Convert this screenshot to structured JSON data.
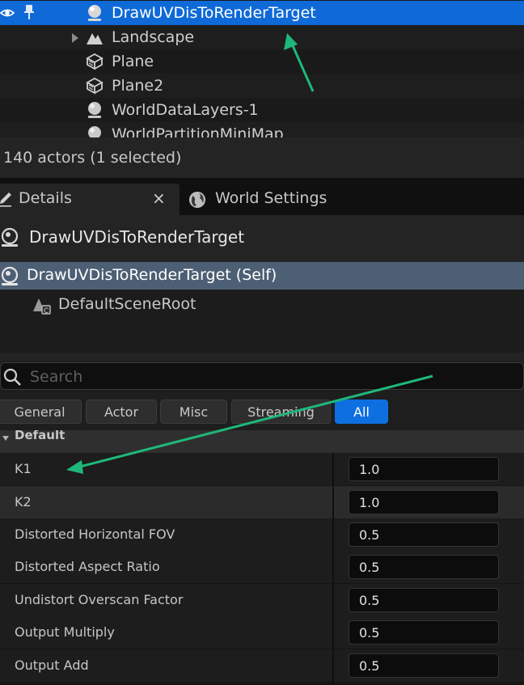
{
  "outliner": {
    "rows": [
      {
        "label": "DrawUVDisToRenderTarget",
        "icon": "actor-sphere-icon",
        "selected": true
      },
      {
        "label": "Landscape",
        "icon": "landscape-icon",
        "expandable": true
      },
      {
        "label": "Plane",
        "icon": "static-mesh-icon"
      },
      {
        "label": "Plane2",
        "icon": "static-mesh-icon"
      },
      {
        "label": "WorldDataLayers-1",
        "icon": "actor-sphere-icon"
      },
      {
        "label": "WorldPartitionMiniMap",
        "icon": "actor-sphere-icon"
      }
    ],
    "status": "140 actors (1 selected)"
  },
  "tabs": {
    "details": "Details",
    "world_settings": "World Settings",
    "close_glyph": "×"
  },
  "details": {
    "actor_name": "DrawUVDisToRenderTarget",
    "components": [
      {
        "label": "DrawUVDisToRenderTarget (Self)",
        "selected": true
      },
      {
        "label": "DefaultSceneRoot"
      }
    ],
    "search_placeholder": "Search",
    "filters": [
      "General",
      "Actor",
      "Misc",
      "Streaming",
      "All"
    ],
    "active_filter": "All",
    "category": "Default",
    "properties": [
      {
        "name": "K1",
        "value": "1.0"
      },
      {
        "name": "K2",
        "value": "1.0"
      },
      {
        "name": "Distorted Horizontal FOV",
        "value": "0.5"
      },
      {
        "name": "Distorted Aspect Ratio",
        "value": "0.5"
      },
      {
        "name": "Undistort Overscan Factor",
        "value": "0.5"
      },
      {
        "name": "Output Multiply",
        "value": "0.5"
      },
      {
        "name": "Output Add",
        "value": "0.5"
      }
    ]
  },
  "colors": {
    "selection": "#0f6ad8",
    "component_selection": "#4d5f74",
    "active_filter": "#0e6fe0",
    "annotation_arrow": "#1fb87a"
  }
}
